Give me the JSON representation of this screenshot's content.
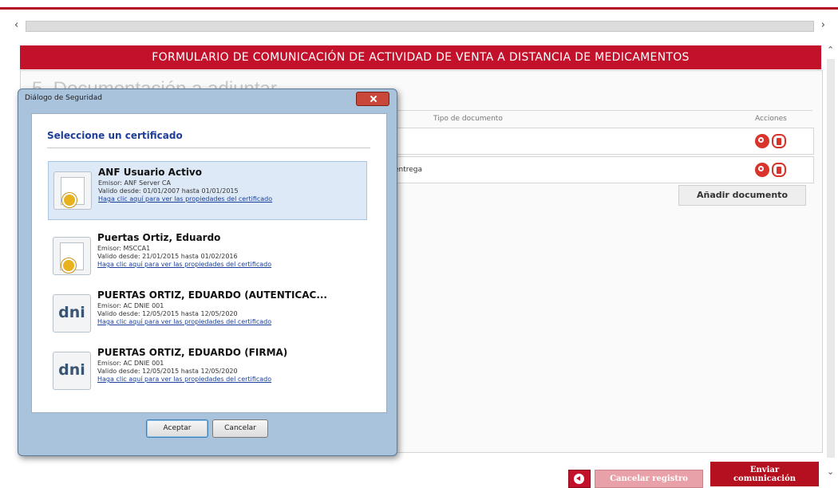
{
  "form": {
    "title": "FORMULARIO DE COMUNICACIÓN DE ACTIVIDAD DE VENTA A DISTANCIA DE MEDICAMENTOS",
    "section_title": "5. Documentación a adjuntar",
    "columns": {
      "type": "Tipo de documento",
      "actions": "Acciones"
    },
    "rows": [
      {
        "type": ""
      },
      {
        "type": "entrega"
      }
    ],
    "add_document_label": "Añadir documento"
  },
  "footer": {
    "cancel_label": "Cancelar registro",
    "send_label_line1": "Enviar",
    "send_label_line2": "comunicación"
  },
  "dialog": {
    "title": "Diálogo de Seguridad",
    "heading": "Seleccione un certificado",
    "certificates": [
      {
        "name": "ANF Usuario Activo",
        "issuer": "Emisor: ANF Server CA",
        "validity": "Valido desde: 01/01/2007 hasta 01/01/2015",
        "link": "Haga clic aquí para ver las propiedades del certificado",
        "icon": "certificate-icon",
        "selected": true
      },
      {
        "name": "Puertas Ortiz, Eduardo",
        "issuer": "Emisor: MSCCA1",
        "validity": "Valido desde: 21/01/2015 hasta 01/02/2016",
        "link": "Haga clic aquí para ver las propiedades del certificado",
        "icon": "certificate-icon",
        "selected": false
      },
      {
        "name": "PUERTAS ORTIZ, EDUARDO (AUTENTICAC...",
        "issuer": "Emisor: AC DNIE 001",
        "validity": "Valido desde: 12/05/2015 hasta 12/05/2020",
        "link": "Haga clic aquí para ver las propiedades del certificado",
        "icon": "dni-icon",
        "icon_text": "dni",
        "selected": false
      },
      {
        "name": "PUERTAS ORTIZ, EDUARDO (FIRMA)",
        "issuer": "Emisor: AC DNIE 001",
        "validity": "Valido desde: 12/05/2015 hasta 12/05/2020",
        "link": "Haga clic aquí para ver las propiedades del certificado",
        "icon": "dni-icon",
        "icon_text": "dni",
        "selected": false
      }
    ],
    "accept_label": "Aceptar",
    "cancel_label": "Cancelar"
  },
  "colors": {
    "brand_red": "#c4112b",
    "dialog_frame": "#a9c3dd",
    "selected_bg": "#dde9f7",
    "heading_blue": "#1e3e9a"
  }
}
